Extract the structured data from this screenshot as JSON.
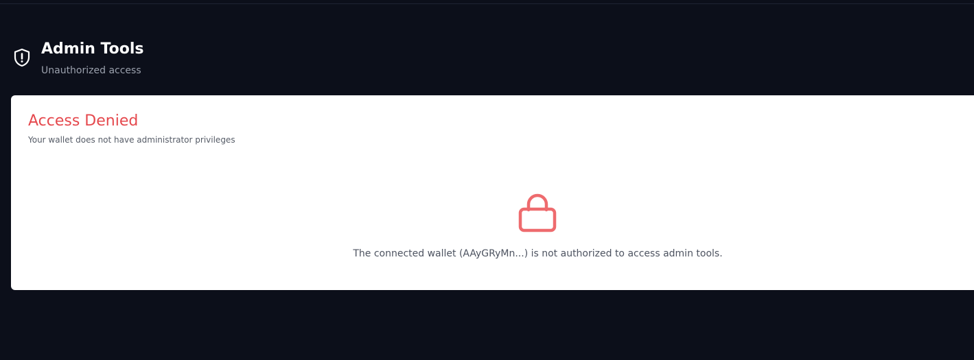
{
  "header": {
    "icon": "shield-alert-icon",
    "title": "Admin Tools",
    "subtitle": "Unauthorized access"
  },
  "card": {
    "title": "Access Denied",
    "description": "Your wallet does not have administrator privileges",
    "icon": "lock-icon",
    "message": "The connected wallet (AAyGRyMn...) is not authorized to access admin tools."
  },
  "colors": {
    "background": "#0c0f1a",
    "danger": "#e5484d",
    "lock": "#ee6b6e",
    "card": "#ffffff"
  }
}
